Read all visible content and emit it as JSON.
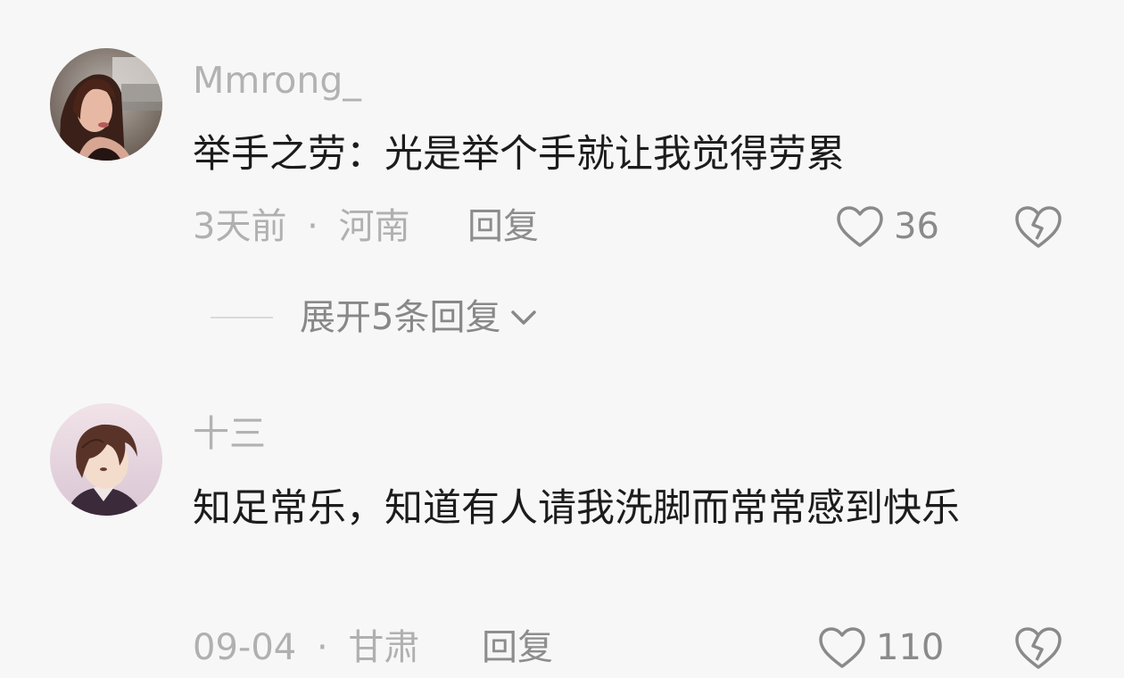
{
  "comments": [
    {
      "username": "Mmrong_",
      "avatar": "avatar-woman-photo",
      "text": "举手之劳：光是举个手就让我觉得劳累",
      "time": "3天前",
      "separator": "·",
      "location": "河南",
      "reply_label": "回复",
      "likes": "36",
      "like_icon": "heart-outline-icon",
      "dislike_icon": "broken-heart-icon",
      "expand_replies_label": "展开5条回复"
    },
    {
      "username": "十三",
      "avatar": "avatar-anime-boy",
      "text": "知足常乐，知道有人请我洗脚而常常感到快乐",
      "time": "09-04",
      "separator": "·",
      "location": "甘肃",
      "reply_label": "回复",
      "likes": "110",
      "like_icon": "heart-outline-icon",
      "dislike_icon": "broken-heart-icon"
    }
  ],
  "colors": {
    "background": "#f7f7f7",
    "username": "#b2b2b2",
    "body_text": "#1c1c1c",
    "meta_text": "#b0b0b0",
    "icon": "#8a8a8a"
  }
}
